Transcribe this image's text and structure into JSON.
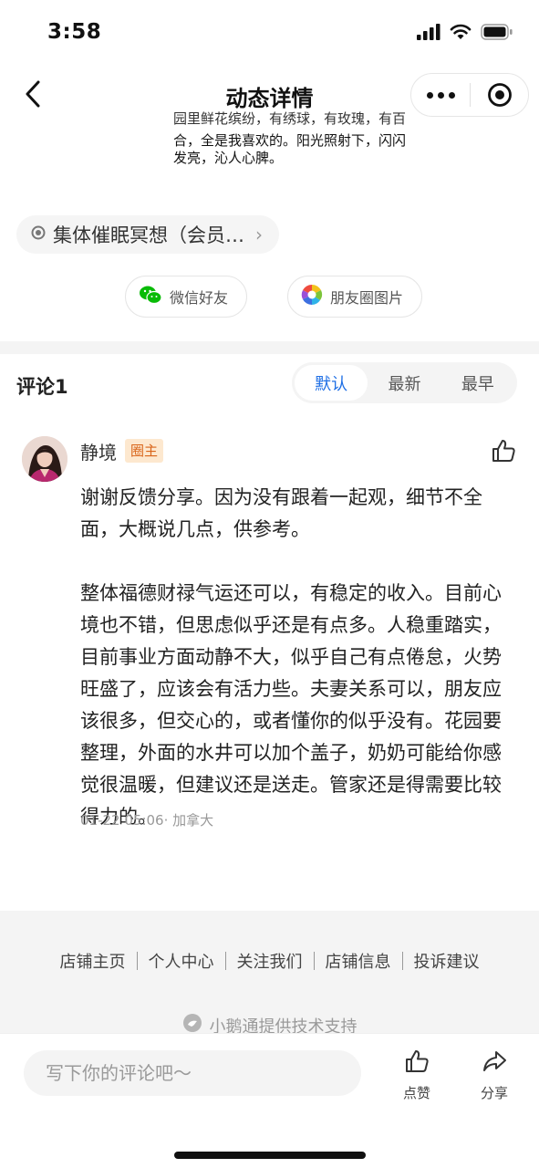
{
  "status_bar": {
    "time": "3:58",
    "icons": [
      "signal-icon",
      "wifi-icon",
      "battery-icon"
    ]
  },
  "nav": {
    "title": "动态详情",
    "back_icon": "chevron-left-icon",
    "more_icon": "more-dots-icon",
    "target_icon": "circle-target-icon"
  },
  "post": {
    "snippet_line1": "园里鲜花缤纷，有绣球，有玫瑰，有百",
    "snippet_line2": "合，全是我喜欢的。阳光照射下，闪闪",
    "snippet_line3": "发亮，沁人心脾。"
  },
  "topic": {
    "label": "集体催眠冥想（会员…",
    "chevron": "›"
  },
  "share": {
    "wechat_label": "微信好友",
    "moments_label": "朋友圈图片"
  },
  "comments": {
    "title": "评论1",
    "sort_options": [
      "默认",
      "最新",
      "最早"
    ],
    "active_sort": "默认",
    "items": [
      {
        "author": "静境",
        "badge": "圈主",
        "paragraph1": "谢谢反馈分享。因为没有跟着一起观，细节不全面，大概说几点，供参考。",
        "paragraph2": "整体福德财禄气运还可以，有稳定的收入。目前心境也不错，但思虑似乎还是有点多。人稳重踏实，目前事业方面动静不大，似乎自己有点倦怠，火势旺盛了，应该会有活力些。夫妻关系可以，朋友应该很多，但交心的，或者懂你的似乎没有。花园要整理，外面的水井可以加个盖子，奶奶可能给你感觉很温暖，但建议还是送走。管家还是得需要比较得力的。",
        "meta": "01-22 05:06· 加拿大"
      }
    ]
  },
  "footer": {
    "links": [
      "店铺主页",
      "个人中心",
      "关注我们",
      "店铺信息",
      "投诉建议"
    ],
    "powered_by": "小鹅通提供技术支持"
  },
  "bottom_bar": {
    "input_placeholder": "写下你的评论吧～",
    "like_label": "点赞",
    "share_label": "分享"
  },
  "colors": {
    "accent": "#1f6fe5",
    "badge_bg": "#fde8cf",
    "badge_text": "#d9651a",
    "wechat_green": "#09bb07",
    "section_bg": "#f4f4f4"
  }
}
